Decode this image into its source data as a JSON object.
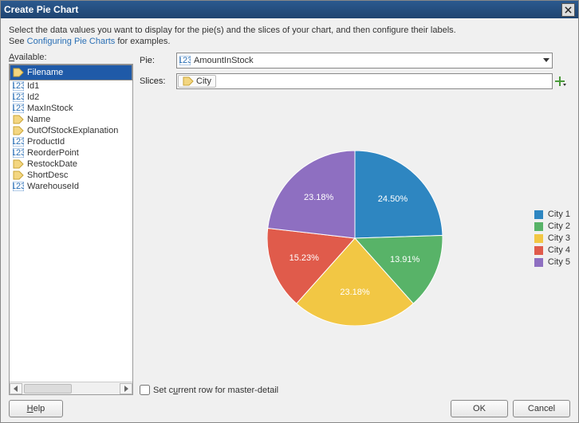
{
  "window": {
    "title": "Create Pie Chart"
  },
  "instruction": {
    "line1": "Select the data values you want to display for the pie(s) and the slices of your chart, and then configure their labels.",
    "line2_pre": "See ",
    "link": "Configuring Pie Charts",
    "line2_post": " for examples."
  },
  "available_label": "Available:",
  "available_items": [
    {
      "label": "Filename",
      "type": "tag",
      "selected": true
    },
    {
      "label": "Id1",
      "type": "num"
    },
    {
      "label": "Id2",
      "type": "num"
    },
    {
      "label": "MaxInStock",
      "type": "num"
    },
    {
      "label": "Name",
      "type": "tag"
    },
    {
      "label": "OutOfStockExplanation",
      "type": "tag"
    },
    {
      "label": "ProductId",
      "type": "num"
    },
    {
      "label": "ReorderPoint",
      "type": "num"
    },
    {
      "label": "RestockDate",
      "type": "tag"
    },
    {
      "label": "ShortDesc",
      "type": "tag"
    },
    {
      "label": "WarehouseId",
      "type": "num"
    }
  ],
  "form": {
    "pie_label": "Pie:",
    "pie_value": "AmountInStock",
    "slices_label": "Slices:",
    "slices_value": "City"
  },
  "checkbox_label": "Set current row for master-detail",
  "buttons": {
    "help": "Help",
    "ok": "OK",
    "cancel": "Cancel"
  },
  "chart_data": {
    "type": "pie",
    "title": "",
    "series": [
      {
        "name": "City 1",
        "value": 24.5,
        "color": "#2e86c1",
        "label": "24.50%"
      },
      {
        "name": "City 2",
        "value": 13.91,
        "color": "#58b368",
        "label": "13.91%"
      },
      {
        "name": "City 3",
        "value": 23.18,
        "color": "#f2c744",
        "label": "23.18%"
      },
      {
        "name": "City 4",
        "value": 15.23,
        "color": "#e05b4b",
        "label": "15.23%"
      },
      {
        "name": "City 5",
        "value": 23.18,
        "color": "#8e6fc1",
        "label": "23.18%"
      }
    ]
  }
}
